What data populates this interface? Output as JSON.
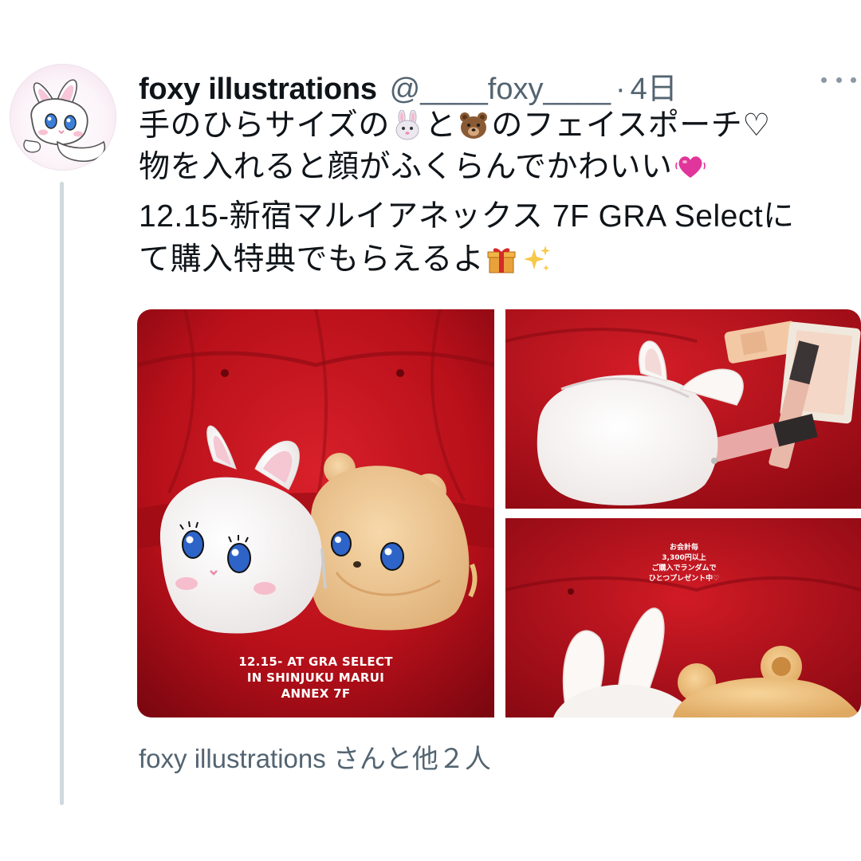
{
  "tweet": {
    "display_name": "foxy illustrations",
    "handle": "@____foxy____",
    "separator": "·",
    "time": "4日",
    "text_lines": {
      "line1_a": "手のひらサイズの",
      "line1_b": "と",
      "line1_c": "のフェイスポーチ♡",
      "line2": "物を入れると顔がふくらんでかわいい",
      "line3": "12.15-新宿マルイアネックス 7F GRA Selectに",
      "line4": "て購入特典でもらえるよ"
    },
    "emoji": {
      "rabbit": "rabbit-face-emoji",
      "bear": "bear-face-emoji",
      "heart": "heartbeat-emoji",
      "gift": "gift-emoji",
      "sparkles": "sparkles-emoji"
    },
    "media": {
      "main_caption": [
        "12.15- AT GRA SELECT",
        "IN SHINJUKU MARUI",
        "ANNEX 7F"
      ],
      "bottom_caption": [
        "お会計毎",
        "3,300円以上",
        "ご購入でランダムで",
        "ひとつプレゼント中♡"
      ]
    },
    "liked_by": "foxy illustrations さんと他２人"
  },
  "colors": {
    "text": "#0f1419",
    "secondary": "#536471",
    "thread_line": "#cfd9de",
    "velvet_red": "#c0141e",
    "pink_heart": "#e0359b"
  }
}
